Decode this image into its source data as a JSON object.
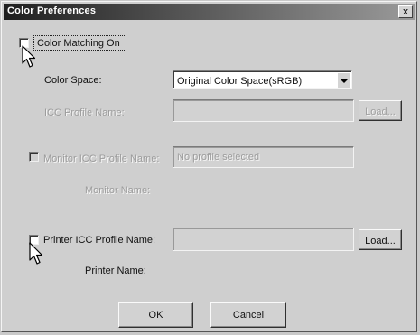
{
  "window": {
    "title": "Color Preferences",
    "close_label": "x"
  },
  "color_matching": {
    "label": "Color Matching On",
    "checked": false
  },
  "color_space": {
    "label": "Color Space:",
    "selected": "Original Color Space(sRGB)"
  },
  "icc_profile": {
    "label": "ICC Profile Name:",
    "value": "",
    "load_label": "Load..."
  },
  "monitor_icc": {
    "label": "Monitor ICC Profile Name:",
    "value": "No profile selected",
    "checked": false
  },
  "monitor_name": {
    "label": "Monitor Name:"
  },
  "printer_icc": {
    "label": "Printer ICC Profile Name:",
    "value": "",
    "checked": false,
    "load_label": "Load..."
  },
  "printer_name": {
    "label": "Printer Name:"
  },
  "buttons": {
    "ok": "OK",
    "cancel": "Cancel"
  },
  "icons": {
    "close": "close-icon",
    "cursor": "mouse-pointer-icon",
    "dropdown": "chevron-down-icon"
  }
}
